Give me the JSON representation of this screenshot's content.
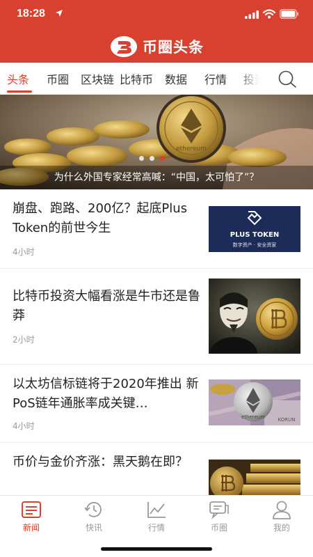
{
  "status": {
    "time": "18:28"
  },
  "brand": {
    "name": "币圈头条"
  },
  "tabs": [
    "头条",
    "币圈",
    "区块链",
    "比特币",
    "数据",
    "行情",
    "投资"
  ],
  "active_tab": "头条",
  "banner": {
    "caption": "为什么外国专家经常高喊：“中国，太可怕了”？",
    "coin_text": "ethereum",
    "slide_count": 3,
    "active_slide": 3
  },
  "articles": [
    {
      "title": "崩盘、跑路、200亿？起底Plus Token的前世今生",
      "time": "4小时",
      "thumb": {
        "brand": "PLUS TOKEN",
        "tagline": "数字资产 · 安全资家"
      }
    },
    {
      "title": "比特币投资大幅看涨是牛市还是鲁莽",
      "time": "2小时"
    },
    {
      "title": "以太坊信标链将于2020年推出 新PoS链年通胀率成关键…",
      "time": "4小时",
      "thumb": {
        "coin_text": "ethereum",
        "note_text": "KORUN"
      }
    },
    {
      "title": "币价与金价齐涨：黑天鹅在即？",
      "time": ""
    }
  ],
  "bottom_nav": [
    {
      "label": "新闻",
      "icon": "news-icon",
      "active": true
    },
    {
      "label": "快讯",
      "icon": "history-icon",
      "active": false
    },
    {
      "label": "行情",
      "icon": "chart-icon",
      "active": false
    },
    {
      "label": "币圈",
      "icon": "chat-icon",
      "active": false
    },
    {
      "label": "我的",
      "icon": "user-icon",
      "active": false
    }
  ],
  "colors": {
    "brand_red": "#d8402f",
    "text": "#222222",
    "muted": "#999999"
  }
}
